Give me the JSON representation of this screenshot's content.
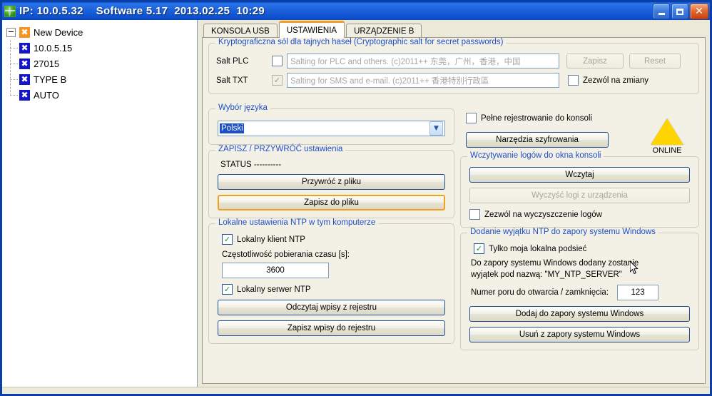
{
  "window": {
    "title": "IP: 10.0.5.32    Software 5.17  2013.02.25  10:29",
    "icon": "globe-network-icon",
    "minimize_label": "",
    "maximize_label": "",
    "close_label": "✕"
  },
  "tree": {
    "root": {
      "label": "New Device",
      "icon": "x-icon-orange"
    },
    "children": [
      {
        "label": "10.0.5.15",
        "icon": "x-icon-blue"
      },
      {
        "label": "27015",
        "icon": "x-icon-blue"
      },
      {
        "label": "TYPE B",
        "icon": "x-icon-blue"
      },
      {
        "label": "AUTO",
        "icon": "x-icon-blue"
      }
    ]
  },
  "tabs": [
    {
      "label": "KONSOLA USB",
      "active": false
    },
    {
      "label": "USTAWIENIA",
      "active": true
    },
    {
      "label": "URZĄDZENIE B",
      "active": false
    }
  ],
  "salt_group": {
    "legend": "Kryptograficzna sól dla tajnych haseł (Cryptographic salt for secret passwords)",
    "rows": [
      {
        "label": "Salt PLC",
        "checked": false,
        "value": "Salting for PLC and others. (c)2011++ 东莞，广州，香港，中国"
      },
      {
        "label": "Salt TXT",
        "checked": true,
        "value": "Salting for SMS and e-mail. (c)2011++ 香港特別行政區"
      }
    ],
    "save_button": "Zapisz",
    "reset_button": "Reset",
    "allow_changes_label": "Zezwól na zmiany",
    "allow_changes_checked": false
  },
  "language_group": {
    "legend": "Wybór języka",
    "selected": "Polski"
  },
  "backup_group": {
    "legend": "ZAPISZ / PRZYWRÓĆ ustawienia",
    "status": "STATUS ----------",
    "restore_button": "Przywróć z pliku",
    "save_button": "Zapisz do pliku"
  },
  "ntp_local_group": {
    "legend": "Lokalne ustawienia NTP w tym komputerze",
    "client_label": "Lokalny klient NTP",
    "client_checked": true,
    "frequency_label": "Częstotliwość pobierania czasu [s]:",
    "frequency_value": "3600",
    "server_label": "Lokalny serwer NTP",
    "server_checked": true,
    "read_registry_button": "Odczytaj wpisy z rejestru",
    "write_registry_button": "Zapisz wpisy do rejestru"
  },
  "console_logging": {
    "full_logging_label": "Pełne rejestrowanie do konsoli",
    "full_logging_checked": false,
    "crypto_tools_button": "Narzędzia szyfrowania",
    "status_indicator": "ONLINE",
    "status_color": "#ffd400"
  },
  "logs_group": {
    "legend": "Wczytywanie logów do okna konsoli",
    "load_button": "Wczytaj",
    "clear_button": "Wyczyść logi z urządzenia",
    "allow_clear_label": "Zezwól na wyczyszczenie logów",
    "allow_clear_checked": false
  },
  "firewall_group": {
    "legend": "Dodanie wyjątku NTP do zapory systemu Windows",
    "local_subnet_label": "Tylko moja lokalna podsieć",
    "local_subnet_checked": true,
    "info_line1": "Do zapory systemu Windows dodany zostanie",
    "info_line2": "wyjątek pod nazwą: \"MY_NTP_SERVER\"",
    "port_label": "Numer poru do otwarcia / zamknięcia:",
    "port_value": "123",
    "add_button": "Dodaj do zapory systemu Windows",
    "remove_button": "Usuń z zapory systemu Windows"
  }
}
